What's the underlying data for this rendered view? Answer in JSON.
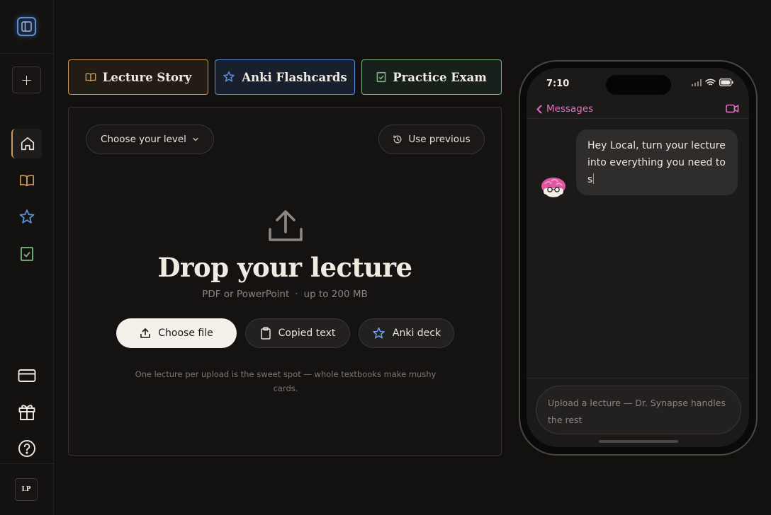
{
  "sidebar": {
    "logo_icon": "sidebar-panel-icon",
    "new_label": "+",
    "nav_items": [
      {
        "name": "home",
        "icon": "home-icon",
        "active": true
      },
      {
        "name": "lecture-story",
        "icon": "book-icon"
      },
      {
        "name": "anki",
        "icon": "sparkle-icon"
      },
      {
        "name": "exam",
        "icon": "checklist-icon"
      }
    ],
    "bottom_items": [
      {
        "name": "billing",
        "icon": "credit-card-icon"
      },
      {
        "name": "gift",
        "icon": "gift-icon"
      },
      {
        "name": "help",
        "icon": "help-icon"
      }
    ],
    "avatar_initials": "LP"
  },
  "tabs": [
    {
      "label": "Lecture Story",
      "icon": "book-icon",
      "color": "#c89a5c"
    },
    {
      "label": "Anki Flashcards",
      "icon": "sparkle-icon",
      "color": "#5a8fd8"
    },
    {
      "label": "Practice Exam",
      "icon": "checklist-icon",
      "color": "#7fb487"
    }
  ],
  "upload": {
    "level_label": "Choose your level",
    "use_previous_label": "Use previous",
    "title": "Drop your lecture",
    "formats": "PDF or PowerPoint",
    "size_limit": "up to 200 MB",
    "separator": "·",
    "choose_file_label": "Choose file",
    "copied_text_label": "Copied text",
    "anki_deck_label": "Anki deck",
    "hint": "One lecture per upload is the sweet spot — whole textbooks make mushy cards."
  },
  "phone": {
    "time": "7:10",
    "back_label": "Messages",
    "accent": "#e36fc6",
    "message": "Hey Local, turn your lecture into everything you need to s",
    "compose_placeholder": "Upload a lecture — Dr. Synapse handles the rest"
  }
}
